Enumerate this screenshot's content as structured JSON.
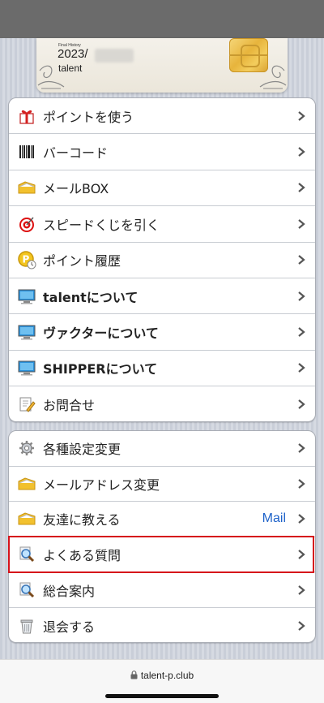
{
  "card": {
    "small_text": "Final History",
    "year": "2023/",
    "name": "talent"
  },
  "menu_main": [
    {
      "label": "ポイントを使う",
      "icon": "gift-icon",
      "bold": false
    },
    {
      "label": "バーコード",
      "icon": "barcode-icon",
      "bold": false
    },
    {
      "label": "メールBOX",
      "icon": "mail-folder-icon",
      "bold": false
    },
    {
      "label": "スピードくじを引く",
      "icon": "target-icon",
      "bold": false
    },
    {
      "label": "ポイント履歴",
      "icon": "point-coin-icon",
      "bold": false
    },
    {
      "label": "talentについて",
      "icon": "monitor-icon",
      "bold": true
    },
    {
      "label": "ヴァクターについて",
      "icon": "monitor-icon",
      "bold": true
    },
    {
      "label": "SHIPPERについて",
      "icon": "monitor-icon",
      "bold": true
    },
    {
      "label": "お問合せ",
      "icon": "note-pencil-icon",
      "bold": false
    }
  ],
  "menu_settings": [
    {
      "label": "各種設定変更",
      "icon": "gear-icon"
    },
    {
      "label": "メールアドレス変更",
      "icon": "mail-folder-icon"
    },
    {
      "label": "友達に教える",
      "icon": "mail-folder-icon",
      "extra": "Mail"
    },
    {
      "label": "よくある質問",
      "icon": "magnifier-icon"
    },
    {
      "label": "総合案内",
      "icon": "magnifier-icon"
    },
    {
      "label": "退会する",
      "icon": "trash-icon"
    }
  ],
  "browser": {
    "url": "talent-p.club"
  },
  "colors": {
    "accent_link": "#1e62c9",
    "highlight": "#d6111a"
  }
}
